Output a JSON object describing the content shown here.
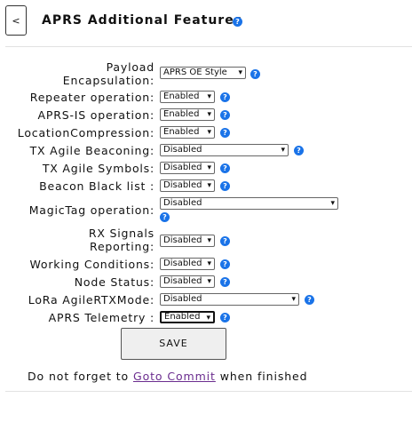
{
  "header": {
    "back_label": "<",
    "title": "APRS Additional Features",
    "help_glyph": "?"
  },
  "settings": [
    {
      "label_line1": "Payload",
      "label_line2": "Encapsulation:",
      "value": "APRS OE Style"
    },
    {
      "label": "Repeater operation:",
      "value": "Enabled"
    },
    {
      "label": "APRS-IS operation:",
      "value": "Enabled"
    },
    {
      "label": "LocationCompression:",
      "value": "Enabled"
    },
    {
      "label": "TX Agile Beaconing:",
      "value": "Disabled"
    },
    {
      "label": "TX Agile Symbols:",
      "value": "Disabled"
    },
    {
      "label": "Beacon Black list :",
      "value": "Disabled"
    },
    {
      "label": "MagicTag operation:",
      "value": "Disabled"
    },
    {
      "label_line1": "RX Signals",
      "label_line2": "Reporting:",
      "value": "Disabled"
    },
    {
      "label": "Working Conditions:",
      "value": "Disabled"
    },
    {
      "label": "Node Status:",
      "value": "Disabled"
    },
    {
      "label": "LoRa AgileRTXMode:",
      "value": "Disabled"
    },
    {
      "label": "APRS Telemetry :",
      "value": "Enabled"
    }
  ],
  "save_label": "SAVE",
  "footer": {
    "before": "Do not forget to ",
    "link": "Goto Commit",
    "after": " when finished"
  },
  "colors": {
    "help_icon": "#1a73e8",
    "link": "#6b2d8f",
    "button_bg": "#efefef"
  }
}
